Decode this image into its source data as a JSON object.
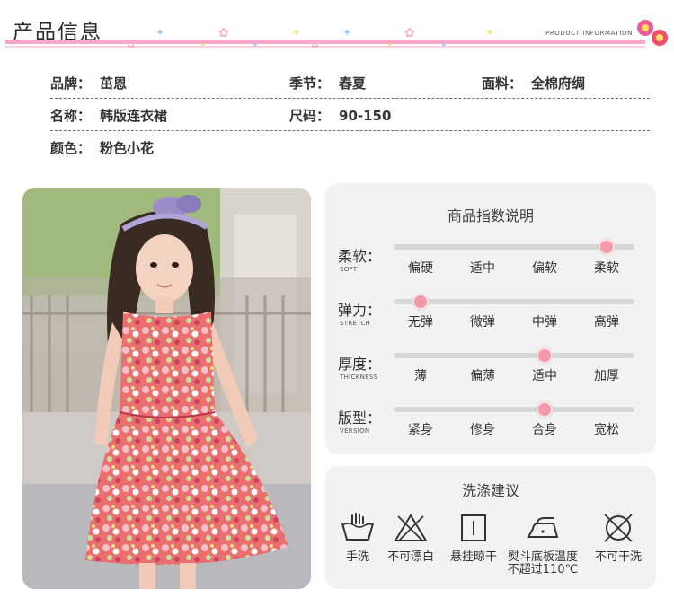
{
  "header": {
    "title": "产品信息",
    "subtitle": "PRODUCT INFORMATION"
  },
  "attributes": {
    "brand": {
      "key": "品牌：",
      "value": "茁恩"
    },
    "season": {
      "key": "季节：",
      "value": "春夏"
    },
    "fabric": {
      "key": "面料：",
      "value": "全棉府绸"
    },
    "name": {
      "key": "名称：",
      "value": "韩版连衣裙"
    },
    "size": {
      "key": "尺码：",
      "value": "90-150"
    },
    "color": {
      "key": "颜色：",
      "value": "粉色小花"
    }
  },
  "index_panel": {
    "title": "商品指数说明",
    "metrics": [
      {
        "label": "柔软：",
        "en": "SOFT",
        "options": [
          "偏硬",
          "适中",
          "偏软",
          "柔软"
        ],
        "selected_index": 3,
        "selected": "柔软"
      },
      {
        "label": "弹力：",
        "en": "STRETCH",
        "options": [
          "无弹",
          "微弹",
          "中弹",
          "高弹"
        ],
        "selected_index": 0,
        "selected": "无弹"
      },
      {
        "label": "厚度：",
        "en": "THICKNESS",
        "options": [
          "薄",
          "偏薄",
          "适中",
          "加厚"
        ],
        "selected_index": 2,
        "selected": "适中"
      },
      {
        "label": "版型：",
        "en": "VERSION",
        "options": [
          "紧身",
          "修身",
          "合身",
          "宽松"
        ],
        "selected_index": 2,
        "selected": "合身"
      }
    ]
  },
  "wash_panel": {
    "title": "洗涤建议",
    "items": [
      {
        "icon": "hand-wash-icon",
        "label": "手洗"
      },
      {
        "icon": "no-bleach-icon",
        "label": "不可漂白"
      },
      {
        "icon": "hang-dry-icon",
        "label": "悬挂晾干"
      },
      {
        "icon": "iron-low-icon",
        "label": "熨斗底板温度",
        "label2": "不超过110℃"
      },
      {
        "icon": "no-dry-clean-icon",
        "label": "不可干洗"
      }
    ]
  },
  "colors": {
    "accent_pink": "#f5a8c7",
    "knob_pink": "#f39aa9",
    "panel_bg": "#f2f2f2"
  }
}
